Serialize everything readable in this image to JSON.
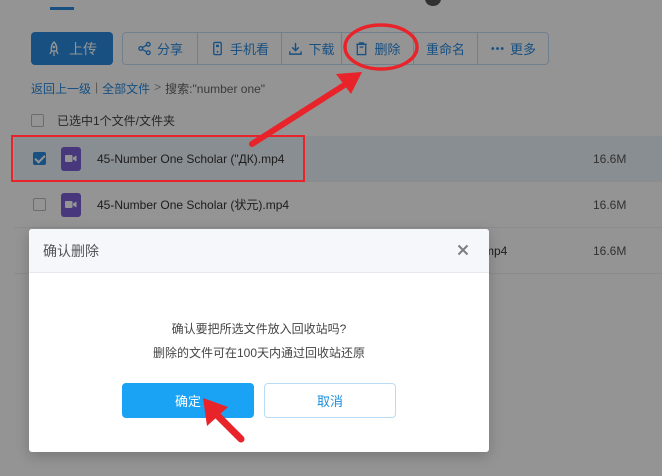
{
  "toolbar": {
    "upload": "上传",
    "share": "分享",
    "mobile": "手机看",
    "download": "下载",
    "delete": "删除",
    "rename": "重命名",
    "more": "更多"
  },
  "breadcrumb": {
    "back": "返回上一级",
    "sep1": "|",
    "all_files": "全部文件",
    "sep2": ">",
    "search_label": "搜索:\"number one\""
  },
  "selection": {
    "summary": "已选中1个文件/文件夹"
  },
  "files": [
    {
      "name": "45-Number One Scholar (\"ДК).mp4",
      "size": "16.6M",
      "selected": true
    },
    {
      "name": "45-Number One Scholar (状元).mp4",
      "size": "16.6M",
      "selected": false
    },
    {
      "name_tail": "mp4",
      "size": "16.6M",
      "selected": false
    }
  ],
  "dialog": {
    "title": "确认删除",
    "message_line1": "确认要把所选文件放入回收站吗?",
    "message_line2": "删除的文件可在100天内通过回收站还原",
    "ok": "确定",
    "cancel": "取消"
  },
  "colors": {
    "accent": "#2a8ae0",
    "annotation_red": "#e8242a",
    "video_icon": "#7c5fd6"
  }
}
